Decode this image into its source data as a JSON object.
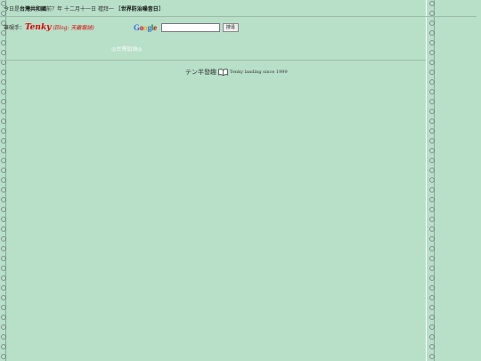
{
  "top": {
    "prefix": "今日是",
    "highlight": "台灣共和國",
    "middle": "前？年 十二月十一日 禮拜一 【",
    "event": "世界防治噪音日",
    "suffix": "】"
  },
  "author": {
    "label": "筆硯手：",
    "name": "Tenky",
    "blog_text": "(Blog: 天霸報誌)"
  },
  "search": {
    "logo_letters": [
      "G",
      "o",
      "o",
      "g",
      "l",
      "e"
    ],
    "placeholder": "",
    "button_label": "搜尋"
  },
  "taiwan_link": "◎台灣加油◎",
  "footer": {
    "brand": "テン半發趣",
    "book_icon": "book-icon",
    "tagline": "Tenky landing since 1999"
  },
  "colors": {
    "background": "#b8dfc8",
    "author": "#dd0000",
    "taiwan": "#ffffff"
  }
}
